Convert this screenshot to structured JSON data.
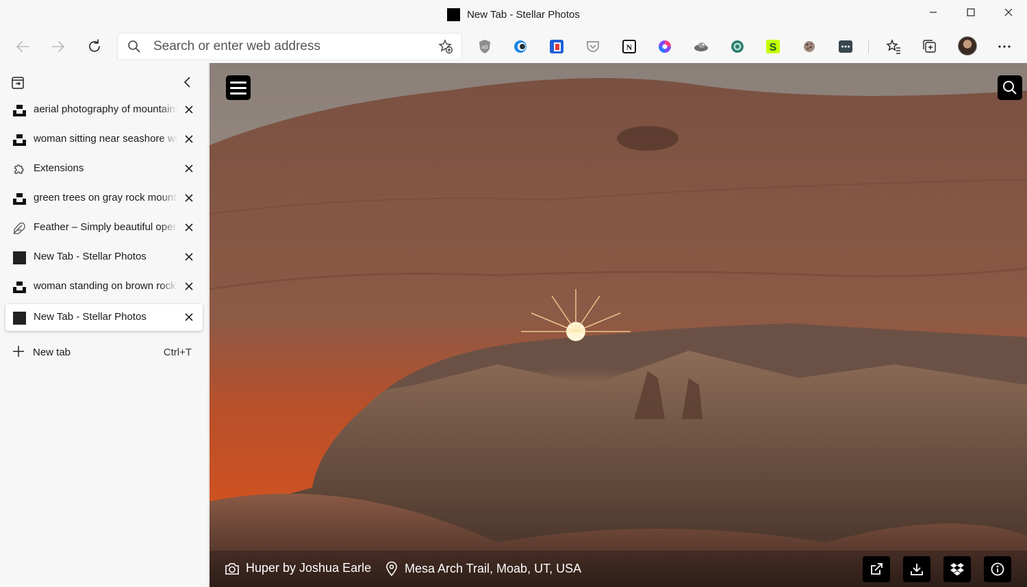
{
  "window": {
    "title": "New Tab - Stellar Photos",
    "controls": [
      "minimize-icon",
      "maximize-icon",
      "close-icon"
    ]
  },
  "toolbar": {
    "address_placeholder": "Search or enter web address",
    "extensions": [
      "ublock-icon",
      "edge-dark-icon",
      "todoist-icon",
      "pocket-icon",
      "notion-icon",
      "color-picker-icon",
      "tampermonkey-icon",
      "grammarly-icon",
      "s-extension-icon",
      "cookie-icon",
      "bitwarden-icon"
    ]
  },
  "sidebar": {
    "tabs": [
      {
        "label": "aerial photography of mountains",
        "favicon": "unsplash"
      },
      {
        "label": "woman sitting near seashore while",
        "favicon": "unsplash"
      },
      {
        "label": "Extensions",
        "favicon": "extensions"
      },
      {
        "label": "green trees on gray rock mountain",
        "favicon": "unsplash"
      },
      {
        "label": "Feather – Simply beautiful open source icons",
        "favicon": "feather"
      },
      {
        "label": "New Tab - Stellar Photos",
        "favicon": "stellar"
      },
      {
        "label": "woman standing on brown rock formation",
        "favicon": "unsplash"
      },
      {
        "label": "New Tab - Stellar Photos",
        "favicon": "stellar",
        "active": true
      }
    ],
    "new_tab_label": "New tab",
    "new_tab_shortcut": "Ctrl+T"
  },
  "photo": {
    "credit": "Huper by Joshua Earle",
    "location": "Mesa Arch Trail, Moab, UT, USA"
  }
}
